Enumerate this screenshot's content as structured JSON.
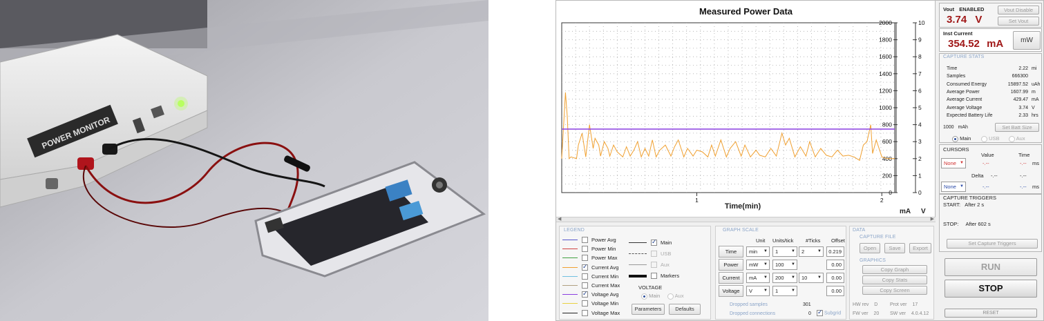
{
  "graph": {
    "title": "Measured Power Data",
    "xlabel": "Time(min)",
    "y_left_unit": "mA",
    "y_right_unit": "V"
  },
  "chart_data": {
    "type": "line",
    "title": "Measured Power Data",
    "xlabel": "Time(min)",
    "ylabel_left": "mA",
    "ylabel_right": "V",
    "xlim": [
      0.27,
      2.07
    ],
    "x_ticks": [
      1,
      2
    ],
    "ylim_left": [
      0,
      2000
    ],
    "ylim_right": [
      0,
      10
    ],
    "y_left_ticks": [
      0,
      200,
      400,
      600,
      800,
      1000,
      1200,
      1400,
      1600,
      1800,
      2000
    ],
    "y_right_ticks": [
      0,
      1,
      2,
      3,
      4,
      5,
      6,
      7,
      8,
      9,
      10
    ],
    "grid": true,
    "series": [
      {
        "name": "Current Avg",
        "color": "#f0a030",
        "axis": "left",
        "x": [
          0.27,
          0.29,
          0.3,
          0.31,
          0.32,
          0.35,
          0.36,
          0.38,
          0.4,
          0.42,
          0.44,
          0.45,
          0.47,
          0.48,
          0.5,
          0.52,
          0.53,
          0.55,
          0.57,
          0.6,
          0.62,
          0.64,
          0.66,
          0.68,
          0.7,
          0.72,
          0.74,
          0.76,
          0.78,
          0.8,
          0.83,
          0.86,
          0.88,
          0.9,
          0.93,
          0.95,
          0.98,
          1.0,
          1.03,
          1.06,
          1.08,
          1.1,
          1.13,
          1.16,
          1.18,
          1.21,
          1.24,
          1.26,
          1.29,
          1.32,
          1.34,
          1.37,
          1.4,
          1.43,
          1.46,
          1.48,
          1.5,
          1.53,
          1.56,
          1.59,
          1.61,
          1.64,
          1.67,
          1.7,
          1.73,
          1.76,
          1.79,
          1.82,
          1.85,
          1.88,
          1.9,
          1.92,
          1.94,
          1.95,
          1.97,
          2.0,
          2.03,
          2.07
        ],
        "y": [
          400,
          1180,
          900,
          400,
          420,
          400,
          560,
          700,
          420,
          800,
          520,
          640,
          560,
          430,
          600,
          520,
          430,
          560,
          480,
          420,
          540,
          430,
          500,
          600,
          420,
          520,
          430,
          620,
          420,
          500,
          560,
          430,
          540,
          620,
          420,
          520,
          430,
          500,
          480,
          420,
          560,
          430,
          620,
          420,
          520,
          600,
          430,
          560,
          420,
          500,
          440,
          420,
          520,
          430,
          700,
          560,
          640,
          420,
          540,
          430,
          600,
          420,
          520,
          440,
          420,
          500,
          430,
          440,
          420,
          380,
          560,
          600,
          800,
          460,
          620,
          420,
          400,
          400
        ]
      },
      {
        "name": "Voltage Avg",
        "color": "#8a3ee0",
        "axis": "right",
        "x": [
          0.27,
          2.07
        ],
        "y": [
          3.74,
          3.74
        ]
      }
    ]
  },
  "legend": {
    "title": "LEGEND",
    "items": [
      {
        "label": "Power Avg",
        "color": "#5555cc",
        "checked": false
      },
      {
        "label": "Power Min",
        "color": "#d04040",
        "checked": false
      },
      {
        "label": "Power Max",
        "color": "#40a040",
        "checked": false
      },
      {
        "label": "Current Avg",
        "color": "#f0a030",
        "checked": true
      },
      {
        "label": "Current Min",
        "color": "#70c0e0",
        "checked": false
      },
      {
        "label": "Current Max",
        "color": "#b0a080",
        "checked": false
      },
      {
        "label": "Voltage Avg",
        "color": "#8a3ee0",
        "checked": true
      },
      {
        "label": "Voltage Min",
        "color": "#e8d040",
        "checked": false
      },
      {
        "label": "Voltage Max",
        "color": "#202020",
        "checked": false
      }
    ],
    "channels": [
      {
        "label": "Main",
        "checked": true,
        "enabled": true
      },
      {
        "label": "USB",
        "checked": false,
        "enabled": false
      },
      {
        "label": "Aux",
        "checked": false,
        "enabled": false
      },
      {
        "label": "Markers",
        "checked": false,
        "enabled": true
      }
    ],
    "voltage_title": "VOLTAGE",
    "voltage_main": "Main",
    "voltage_aux": "Aux",
    "parameters_btn": "Parameters",
    "defaults_btn": "Defaults"
  },
  "graph_scale": {
    "title": "GRAPH SCALE",
    "headers": {
      "unit": "Unit",
      "units_tick": "Units/tick",
      "ticks": "#Ticks",
      "offset": "Offset"
    },
    "rows": [
      {
        "label": "Time",
        "unit": "min",
        "units_tick": "1",
        "ticks": "2",
        "offset": "0.219"
      },
      {
        "label": "Power",
        "unit": "mW",
        "units_tick": "100",
        "ticks": "",
        "offset": "0.00"
      },
      {
        "label": "Current",
        "unit": "mA",
        "units_tick": "200",
        "ticks": "10",
        "offset": "0.00"
      },
      {
        "label": "Voltage",
        "unit": "V",
        "units_tick": "1",
        "ticks": "",
        "offset": "0.00"
      }
    ],
    "dropped_samples_label": "Dropped samples",
    "dropped_samples": "301",
    "dropped_connections_label": "Dropped connections",
    "dropped_connections": "0",
    "subgrid_label": "Subgrid"
  },
  "data_panel": {
    "title": "DATA",
    "capture_file": "CAPTURE FILE",
    "open": "Open",
    "save": "Save",
    "export": "Export",
    "graphics": "GRAPHICS",
    "copy_graph": "Copy Graph",
    "copy_stats": "Copy Stats",
    "copy_screen": "Copy Screen",
    "hw_rev_label": "HW rev",
    "hw_rev": "D",
    "prot_ver_label": "Prot ver",
    "prot_ver": "17",
    "fw_ver_label": "FW ver",
    "fw_ver": "20",
    "sw_ver_label": "SW ver",
    "sw_ver": "4.0.4.12"
  },
  "vout": {
    "label": "Vout",
    "status": "ENABLED",
    "value": "3.74",
    "unit": "V",
    "disable_btn": "Vout Disable",
    "set_btn": "Set Vout"
  },
  "inst_current": {
    "label": "Inst Current",
    "value": "354.52",
    "unit": "mA",
    "mw_btn": "mW"
  },
  "capture_stats": {
    "title": "CAPTURE STATS",
    "items": [
      {
        "label": "Time",
        "value": "2.22",
        "unit": "mi"
      },
      {
        "label": "Samples",
        "value": "666300",
        "unit": ""
      },
      {
        "label": "Consumed Energy",
        "value": "15897.52",
        "unit": "uAh"
      },
      {
        "label": "Average Power",
        "value": "1607.99",
        "unit": "m"
      },
      {
        "label": "Average Current",
        "value": "429.47",
        "unit": "mA"
      },
      {
        "label": "Average Voltage",
        "value": "3.74",
        "unit": "V"
      },
      {
        "label": "Expected Battery Life",
        "value": "2.33",
        "unit": "hrs"
      }
    ],
    "batt_size": "1000",
    "batt_unit": "mAh",
    "set_batt_btn": "Set Batt Size",
    "src_main": "Main",
    "src_usb": "USB",
    "src_aux": "Aux"
  },
  "cursors": {
    "title": "CURSORS",
    "value_head": "Value",
    "time_head": "Time",
    "none1": "None",
    "val1": "-.--",
    "time1": "-.--",
    "ms1": "ms",
    "delta": "Delta",
    "dval": "-.--",
    "dtime": "-.--",
    "none2": "None",
    "val2": "-.--",
    "time2": "-.--",
    "ms2": "ms"
  },
  "triggers": {
    "title": "CAPTURE TRIGGERS",
    "start_label": "START:",
    "start_value": "After 2 s",
    "stop_label": "STOP:",
    "stop_value": "After 602 s",
    "set_btn": "Set Capture Triggers"
  },
  "controls": {
    "run": "RUN",
    "stop": "STOP",
    "reset": "RESET"
  },
  "photo": {
    "device_label": "POWER MONITOR"
  }
}
